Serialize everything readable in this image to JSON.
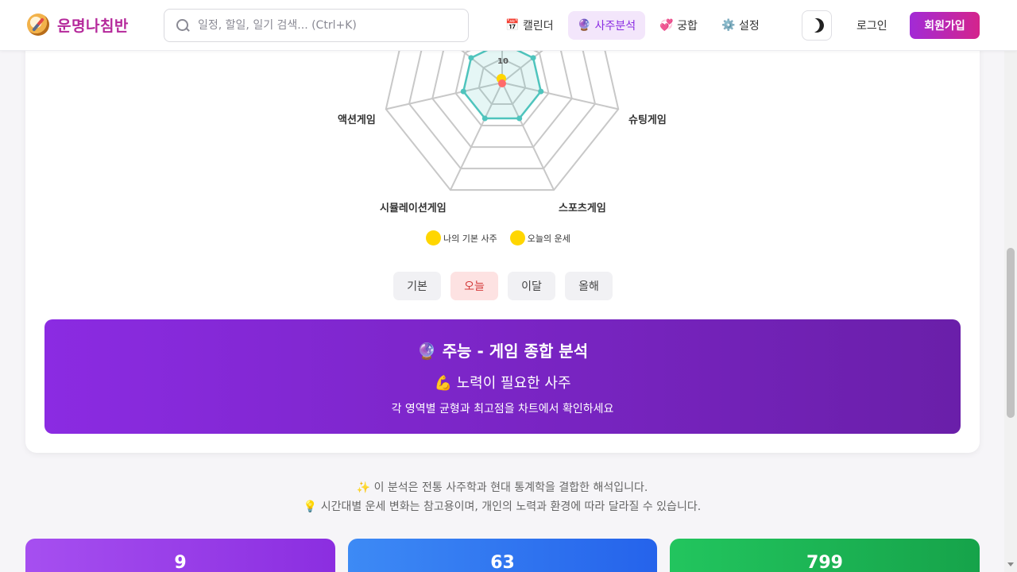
{
  "header": {
    "logo_text": "운명나침반",
    "search_placeholder": "일정, 할일, 일기 검색... (Ctrl+K)",
    "nav": [
      {
        "label": "캘린더",
        "icon": "calendar-icon",
        "glyph": "📅",
        "active": false
      },
      {
        "label": "사주분석",
        "icon": "crystal-ball-icon",
        "glyph": "🔮",
        "active": true
      },
      {
        "label": "궁합",
        "icon": "hearts-icon",
        "glyph": "💞",
        "active": false
      },
      {
        "label": "설정",
        "icon": "gear-icon",
        "glyph": "⚙️",
        "active": false
      }
    ],
    "login_label": "로그인",
    "signup_label": "회원가입"
  },
  "chart_data": {
    "type": "radar",
    "axes": [
      "액션게임",
      "슈팅게임",
      "스포츠게임",
      "시뮬레이션게임"
    ],
    "tick_label": "10",
    "legend": [
      "나의 기본 사주",
      "오늘의 운세"
    ],
    "colors": {
      "teal": "#4fc4bd",
      "yellow": "#ffd600",
      "red": "#ff6b6b"
    }
  },
  "periods": [
    {
      "label": "기본",
      "active": false
    },
    {
      "label": "오늘",
      "active": true
    },
    {
      "label": "이달",
      "active": false
    },
    {
      "label": "올해",
      "active": false
    }
  ],
  "summary": {
    "title": "🔮 주능 - 게임 종합 분석",
    "subtitle": "💪 노력이 필요한 사주",
    "note": "각 영역별 균형과 최고점을 차트에서 확인하세요"
  },
  "footnotes": [
    "✨ 이 분석은 전통 사주학과 현대 통계학을 결합한 해석입니다.",
    "💡 시간대별 운세 변화는 참고용이며, 개인의 노력과 환경에 따라 달라질 수 있습니다."
  ],
  "stats": [
    {
      "value": "9",
      "from": "#a64ff0",
      "to": "#8b2ee0"
    },
    {
      "value": "63",
      "from": "#3d8af5",
      "to": "#2563eb"
    },
    {
      "value": "799",
      "from": "#22c55e",
      "to": "#16a34a"
    }
  ]
}
